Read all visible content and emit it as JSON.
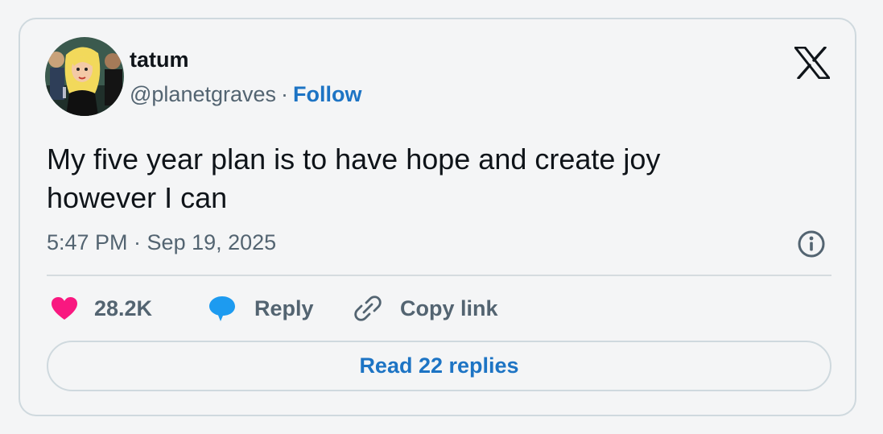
{
  "author": {
    "name": "tatum",
    "handle": "@planetgraves",
    "separator": "·",
    "follow_label": "Follow"
  },
  "tweet": {
    "text": "My five year plan is to have hope and create joy however I can",
    "timestamp": "5:47 PM · Sep 19, 2025"
  },
  "actions": {
    "likes_count": "28.2K",
    "reply_label": "Reply",
    "copy_link_label": "Copy link"
  },
  "read_replies_label": "Read 22 replies",
  "icons": {
    "logo": "x-logo-icon",
    "info": "info-icon",
    "like": "heart-icon",
    "reply": "speech-bubble-icon",
    "copy": "link-icon"
  },
  "colors": {
    "background": "#f4f5f6",
    "border": "#cfd9de",
    "text_primary": "#0f1419",
    "text_secondary": "#536471",
    "link_blue": "#1d74c4",
    "like_pink": "#f91880",
    "reply_blue": "#1d9bf0"
  }
}
